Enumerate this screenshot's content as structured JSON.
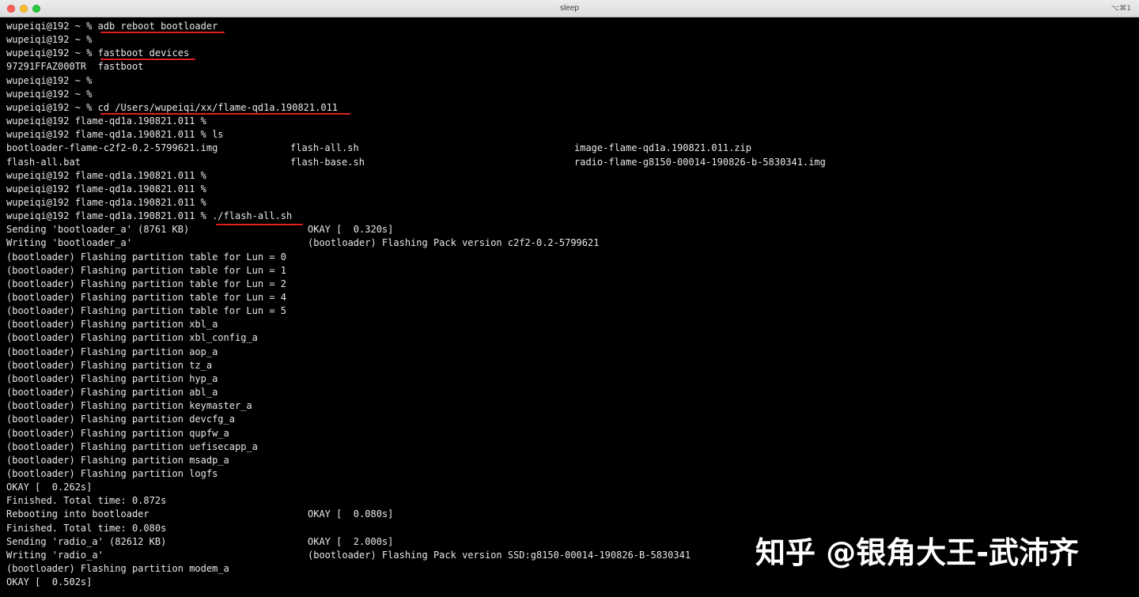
{
  "window": {
    "title": "sleep",
    "shortcut": "⌥⌘1"
  },
  "terminal": {
    "lines": [
      {
        "c0": "wupeiqi@192 ~ % adb reboot bootloader"
      },
      {
        "c0": "wupeiqi@192 ~ %"
      },
      {
        "c0": "wupeiqi@192 ~ % fastboot devices"
      },
      {
        "c0": "97291FFAZ000TR  fastboot"
      },
      {
        "c0": "wupeiqi@192 ~ %"
      },
      {
        "c0": "wupeiqi@192 ~ %"
      },
      {
        "c0": "wupeiqi@192 ~ % cd /Users/wupeiqi/xx/flame-qd1a.190821.011"
      },
      {
        "c0": "wupeiqi@192 flame-qd1a.190821.011 %"
      },
      {
        "c0": "wupeiqi@192 flame-qd1a.190821.011 % ls"
      },
      {
        "c0": "bootloader-flame-c2f2-0.2-5799621.img",
        "c1": "flash-all.sh",
        "c2": "image-flame-qd1a.190821.011.zip"
      },
      {
        "c0": "flash-all.bat",
        "c1": "flash-base.sh",
        "c2": "radio-flame-g8150-00014-190826-b-5830341.img"
      },
      {
        "c0": "wupeiqi@192 flame-qd1a.190821.011 %"
      },
      {
        "c0": "wupeiqi@192 flame-qd1a.190821.011 %"
      },
      {
        "c0": "wupeiqi@192 flame-qd1a.190821.011 %"
      },
      {
        "c0": "wupeiqi@192 flame-qd1a.190821.011 % ./flash-all.sh"
      },
      {
        "c0": "Sending 'bootloader_a' (8761 KB)",
        "c3": "OKAY [  0.320s]"
      },
      {
        "c0": "Writing 'bootloader_a'",
        "c3": "(bootloader) Flashing Pack version c2f2-0.2-5799621"
      },
      {
        "c0": "(bootloader) Flashing partition table for Lun = 0"
      },
      {
        "c0": "(bootloader) Flashing partition table for Lun = 1"
      },
      {
        "c0": "(bootloader) Flashing partition table for Lun = 2"
      },
      {
        "c0": "(bootloader) Flashing partition table for Lun = 4"
      },
      {
        "c0": "(bootloader) Flashing partition table for Lun = 5"
      },
      {
        "c0": "(bootloader) Flashing partition xbl_a"
      },
      {
        "c0": "(bootloader) Flashing partition xbl_config_a"
      },
      {
        "c0": "(bootloader) Flashing partition aop_a"
      },
      {
        "c0": "(bootloader) Flashing partition tz_a"
      },
      {
        "c0": "(bootloader) Flashing partition hyp_a"
      },
      {
        "c0": "(bootloader) Flashing partition abl_a"
      },
      {
        "c0": "(bootloader) Flashing partition keymaster_a"
      },
      {
        "c0": "(bootloader) Flashing partition devcfg_a"
      },
      {
        "c0": "(bootloader) Flashing partition qupfw_a"
      },
      {
        "c0": "(bootloader) Flashing partition uefisecapp_a"
      },
      {
        "c0": "(bootloader) Flashing partition msadp_a"
      },
      {
        "c0": "(bootloader) Flashing partition logfs"
      },
      {
        "c0": "OKAY [  0.262s]"
      },
      {
        "c0": "Finished. Total time: 0.872s"
      },
      {
        "c0": "Rebooting into bootloader",
        "c3": "OKAY [  0.080s]"
      },
      {
        "c0": "Finished. Total time: 0.080s"
      },
      {
        "c0": "Sending 'radio_a' (82612 KB)",
        "c3": "OKAY [  2.000s]"
      },
      {
        "c0": "Writing 'radio_a'",
        "c3": "(bootloader) Flashing Pack version SSD:g8150-00014-190826-B-5830341"
      },
      {
        "c0": "(bootloader) Flashing partition modem_a"
      },
      {
        "c0": "OKAY [  0.502s]"
      }
    ]
  },
  "annotations": {
    "underline_color": "#e0201a"
  },
  "watermark": {
    "text": "知乎 @银角大王-武沛齐"
  }
}
